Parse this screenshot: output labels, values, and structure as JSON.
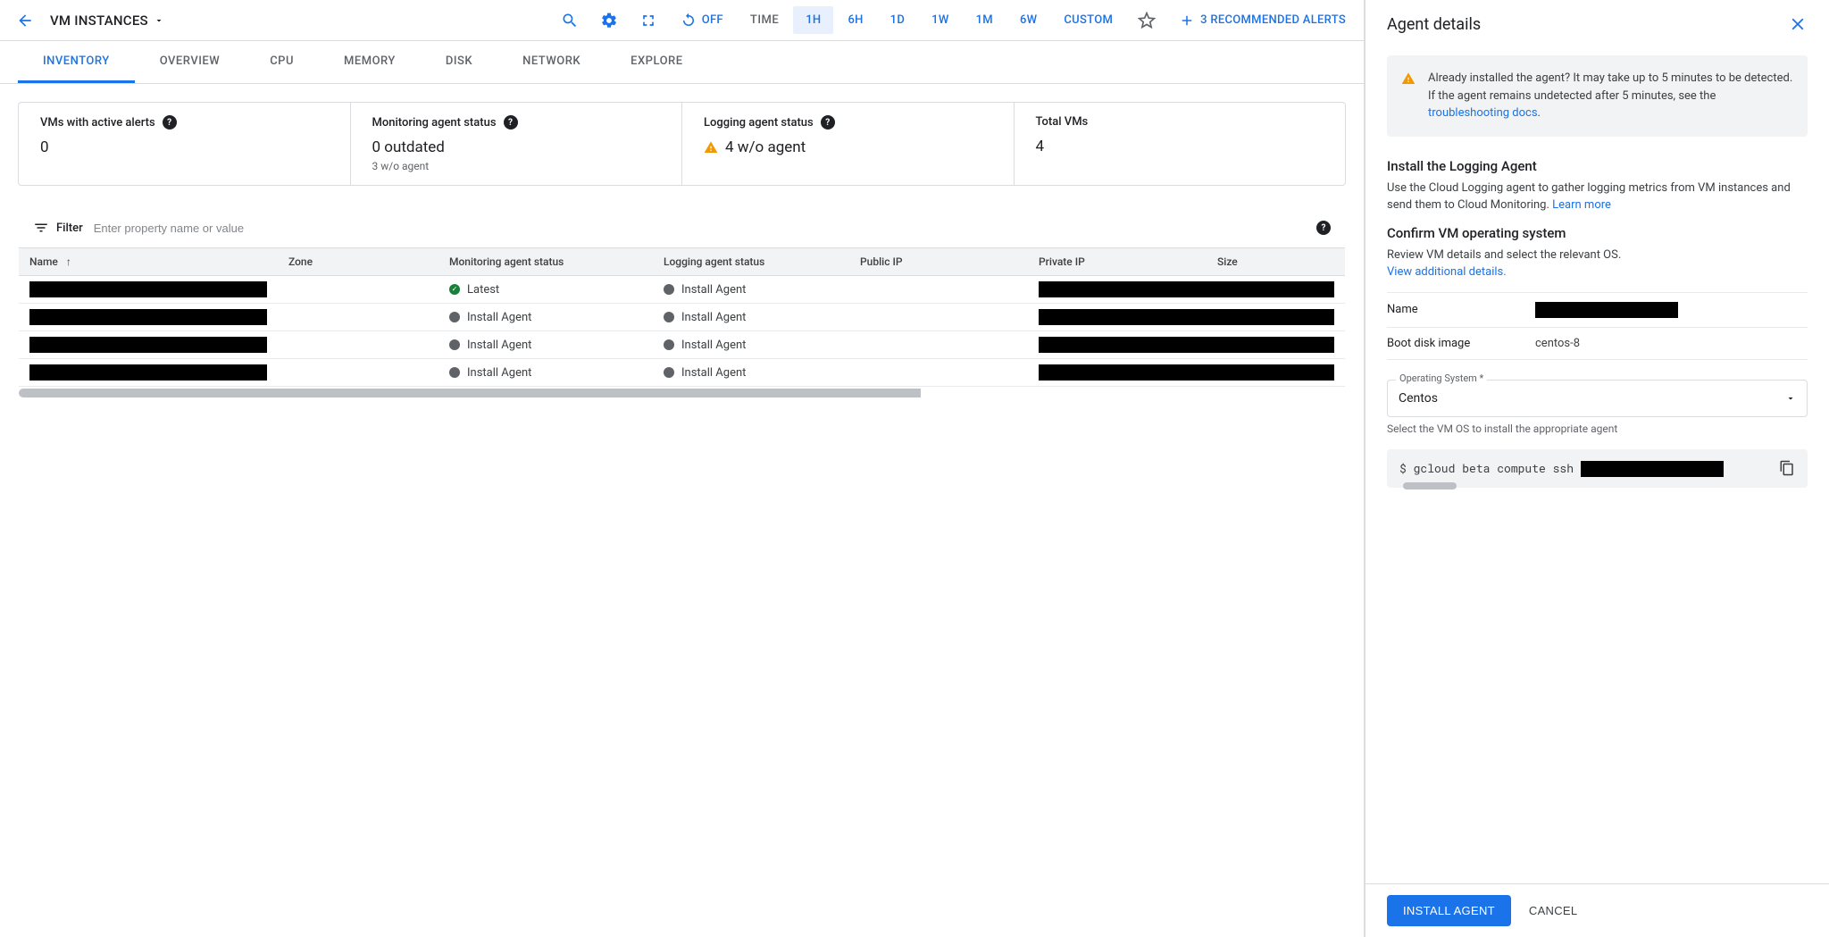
{
  "colors": {
    "accent": "#1a73e8",
    "warn": "#f29900",
    "ok": "#188038"
  },
  "topbar": {
    "title": "VM INSTANCES",
    "off_label": "OFF",
    "time_label": "TIME",
    "time_options": [
      "1H",
      "6H",
      "1D",
      "1W",
      "1M",
      "6W",
      "CUSTOM"
    ],
    "time_selected": "1H",
    "rec_alerts": "3 RECOMMENDED ALERTS"
  },
  "tabs": [
    "INVENTORY",
    "OVERVIEW",
    "CPU",
    "MEMORY",
    "DISK",
    "NETWORK",
    "EXPLORE"
  ],
  "active_tab": "INVENTORY",
  "summary": {
    "active_alerts": {
      "label": "VMs with active alerts",
      "value": "0"
    },
    "monitoring": {
      "label": "Monitoring agent status",
      "value": "0 outdated",
      "sub": "3 w/o agent"
    },
    "logging": {
      "label": "Logging agent status",
      "value": "4 w/o agent"
    },
    "total": {
      "label": "Total VMs",
      "value": "4"
    }
  },
  "filter": {
    "label": "Filter",
    "placeholder": "Enter property name or value"
  },
  "columns": [
    "Name",
    "Zone",
    "Monitoring agent status",
    "Logging agent status",
    "Public IP",
    "Private IP",
    "Size"
  ],
  "rows": [
    {
      "monitoring_status": "Latest",
      "monitoring_ok": true,
      "logging_status": "Install Agent"
    },
    {
      "monitoring_status": "Install Agent",
      "monitoring_ok": false,
      "logging_status": "Install Agent"
    },
    {
      "monitoring_status": "Install Agent",
      "monitoring_ok": false,
      "logging_status": "Install Agent"
    },
    {
      "monitoring_status": "Install Agent",
      "monitoring_ok": false,
      "logging_status": "Install Agent"
    }
  ],
  "panel": {
    "title": "Agent details",
    "info": {
      "text_pre": "Already installed the agent? It may take up to 5 minutes to be detected. If the agent remains undetected after 5 minutes, see the ",
      "link": "troubleshooting docs",
      "text_post": "."
    },
    "install_heading": "Install the Logging Agent",
    "install_body_pre": "Use the Cloud Logging agent to gather logging metrics from VM instances and send them to Cloud Monitoring. ",
    "learn_more": "Learn more",
    "confirm_heading": "Confirm VM operating system",
    "confirm_body": "Review VM details and select the relevant OS.",
    "view_details": "View additional details.",
    "kv_name_label": "Name",
    "kv_boot_label": "Boot disk image",
    "kv_boot_value": "centos-8",
    "os_label": "Operating System *",
    "os_value": "Centos",
    "os_help": "Select the VM OS to install the appropriate agent",
    "command": "$ gcloud beta compute ssh ",
    "install_btn": "INSTALL AGENT",
    "cancel_btn": "CANCEL"
  }
}
